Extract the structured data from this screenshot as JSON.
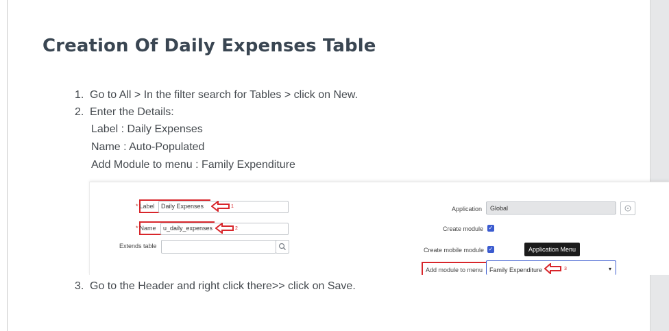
{
  "title": "Creation Of Daily Expenses Table",
  "steps": [
    {
      "number": "1.",
      "text": "Go to All > In the filter search for Tables > click on New."
    },
    {
      "number": "2.",
      "text": "Enter the Details:"
    },
    {
      "number": "3.",
      "text": "Go to the Header and right click there>> click on Save."
    }
  ],
  "details": [
    "Label : Daily Expenses",
    "Name : Auto-Populated",
    "Add Module to menu : Family Expenditure"
  ],
  "form": {
    "label_label": "Label",
    "label_value": "Daily Expenses",
    "name_label": "Name",
    "name_value": "u_daily_expenses",
    "extends_label": "Extends table",
    "application_label": "Application",
    "application_value": "Global",
    "create_module_label": "Create module",
    "create_mobile_module_label": "Create mobile module",
    "add_module_label": "Add module to menu",
    "add_module_value": "Family Expenditure",
    "tooltip": "Application Menu",
    "create_module_checked": true,
    "create_mobile_module_checked": true
  },
  "annotations": [
    "1",
    "2",
    "3"
  ],
  "colors": {
    "annotation_red": "#d8262b",
    "checkbox_blue": "#3b5bcf",
    "title": "#3a4652"
  }
}
